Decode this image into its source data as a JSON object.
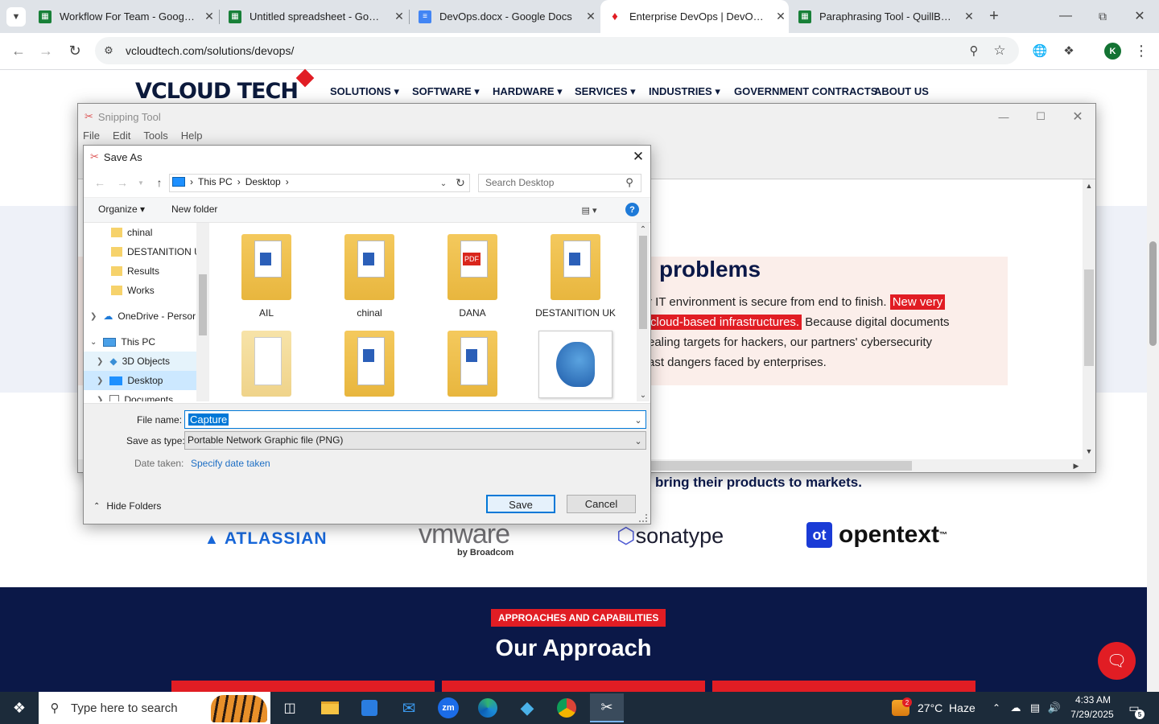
{
  "browser": {
    "tabs": [
      {
        "title": "Workflow For Team - Google Sh",
        "icon": "sheets-icon"
      },
      {
        "title": "Untitled spreadsheet - Google",
        "icon": "sheets-icon"
      },
      {
        "title": "DevOps.docx - Google Docs",
        "icon": "docs-icon"
      },
      {
        "title": "Enterprise DevOps | DevOps Fr",
        "icon": "vcloud-icon"
      },
      {
        "title": "Paraphrasing Tool - QuillBot AI",
        "icon": "quillbot-icon"
      }
    ],
    "url": "vcloudtech.com/solutions/devops/",
    "profile_initial": "K"
  },
  "site": {
    "logo": "VCLOUD TECH",
    "nav": [
      "SOLUTIONS",
      "SOFTWARE",
      "HARDWARE",
      "SERVICES",
      "INDUSTRIES",
      "GOVERNMENT CONTRACTS",
      "ABOUT US"
    ],
    "heading_fragment": "problems",
    "para_line1_a": "r IT environment is secure from end to finish.",
    "para_line1_hl": "New very",
    "para_line2_hl": "cloud-based infrastructures.",
    "para_line2_b": "Because digital documents",
    "para_line3": "ealing targets for hackers, our partners' cybersecurity",
    "para_line4": "ast dangers faced by enterprises.",
    "products_text": "bring their products to markets.",
    "partners": [
      "ATLASSIAN",
      "vmware",
      "by Broadcom",
      "sonatype",
      "opentext"
    ],
    "badge": "APPROACHES AND CAPABILITIES",
    "approach_title": "Our Approach"
  },
  "snipping": {
    "title": "Snipping Tool",
    "menu": [
      "File",
      "Edit",
      "Tools",
      "Help"
    ]
  },
  "dialog": {
    "title": "Save As",
    "breadcrumb": [
      "This PC",
      "Desktop"
    ],
    "search_placeholder": "Search Desktop",
    "organize": "Organize",
    "new_folder": "New folder",
    "tree": {
      "folders": [
        "chinal",
        "DESTANITION UK",
        "Results",
        "Works"
      ],
      "onedrive": "OneDrive - Persor",
      "thispc": "This PC",
      "children": [
        "3D Objects",
        "Desktop",
        "Documents"
      ]
    },
    "files": [
      "AIL",
      "chinal",
      "DANA",
      "DESTANITION UK"
    ],
    "filename_label": "File name:",
    "filename_value": "Capture",
    "type_label": "Save as type:",
    "type_value": "Portable Network Graphic file (PNG)",
    "date_label": "Date taken:",
    "date_link": "Specify date taken",
    "hide_folders": "Hide Folders",
    "save": "Save",
    "cancel": "Cancel"
  },
  "taskbar": {
    "search_placeholder": "Type here to search",
    "weather": "27°C  Haze",
    "weather_badge": "2",
    "time": "4:33 AM",
    "date": "7/29/2025",
    "notif_count": "5"
  },
  "colors": {
    "accent_red": "#e11d24",
    "navy": "#0b1848",
    "win_blue": "#0078d7"
  }
}
